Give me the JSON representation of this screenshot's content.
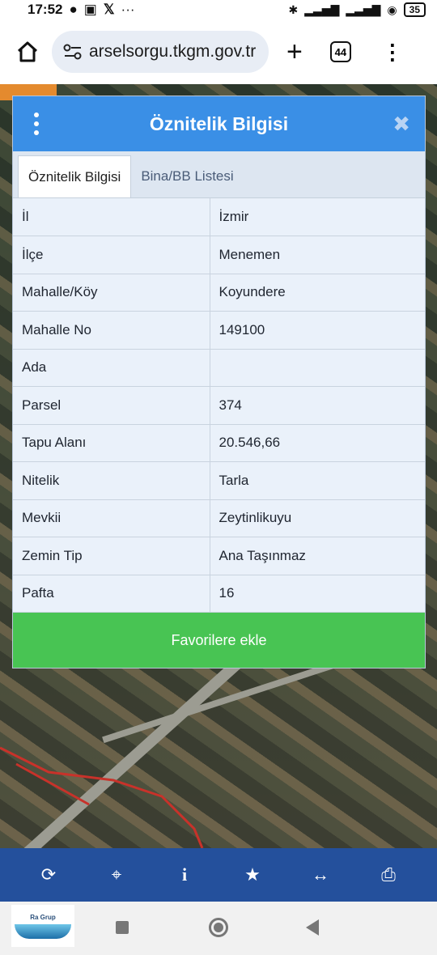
{
  "status_bar": {
    "time": "17:52",
    "battery": "35"
  },
  "browser": {
    "url": "arselsorgu.tkgm.gov.tr",
    "tab_count": "44"
  },
  "modal": {
    "title": "Öznitelik Bilgisi",
    "tabs": [
      {
        "label": "Öznitelik Bilgisi",
        "active": true
      },
      {
        "label": "Bina/BB Listesi",
        "active": false
      }
    ],
    "rows": [
      {
        "key": "İl",
        "value": "İzmir"
      },
      {
        "key": "İlçe",
        "value": "Menemen"
      },
      {
        "key": "Mahalle/Köy",
        "value": "Koyundere"
      },
      {
        "key": "Mahalle No",
        "value": "149100"
      },
      {
        "key": "Ada",
        "value": ""
      },
      {
        "key": "Parsel",
        "value": "374"
      },
      {
        "key": "Tapu Alanı",
        "value": "20.546,66"
      },
      {
        "key": "Nitelik",
        "value": "Tarla"
      },
      {
        "key": "Mevkii",
        "value": "Zeytinlikuyu"
      },
      {
        "key": "Zemin Tip",
        "value": "Ana Taşınmaz"
      },
      {
        "key": "Pafta",
        "value": "16"
      }
    ],
    "favorite_button": "Favorilere ekle"
  },
  "toolbar": {
    "icons": [
      "refresh-icon",
      "locate-icon",
      "info-icon",
      "star-icon",
      "measure-icon",
      "print-icon"
    ]
  },
  "logo": {
    "text": "Ra Grup"
  },
  "colors": {
    "header_blue": "#3a8fe6",
    "favorite_green": "#48c453",
    "toolbar_blue": "#24509c"
  }
}
